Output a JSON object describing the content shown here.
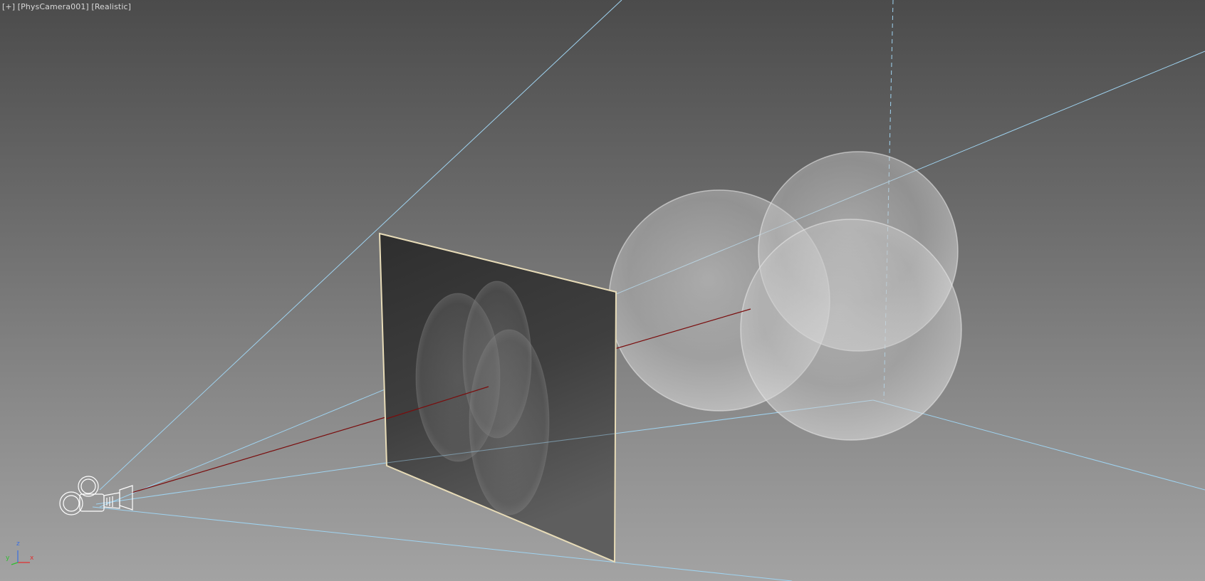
{
  "viewport": {
    "menu_label": "[+]",
    "camera_label": "[PhysCamera001]",
    "shading_label": "[Realistic]"
  },
  "gizmo": {
    "z": "z",
    "y": "y",
    "x": "x"
  },
  "colors": {
    "frustum_lines": "#9fd3f0",
    "target_line": "#7a0d0d",
    "plane_border": "#e8dcb8",
    "camera_wire": "#ffffff",
    "axis_x": "#e03030",
    "axis_y": "#2fbf2f",
    "axis_z": "#3a6fe0"
  },
  "icons": {
    "camera": "physical-camera-icon",
    "axis_gizmo": "xyz-axis-gizmo-icon"
  }
}
